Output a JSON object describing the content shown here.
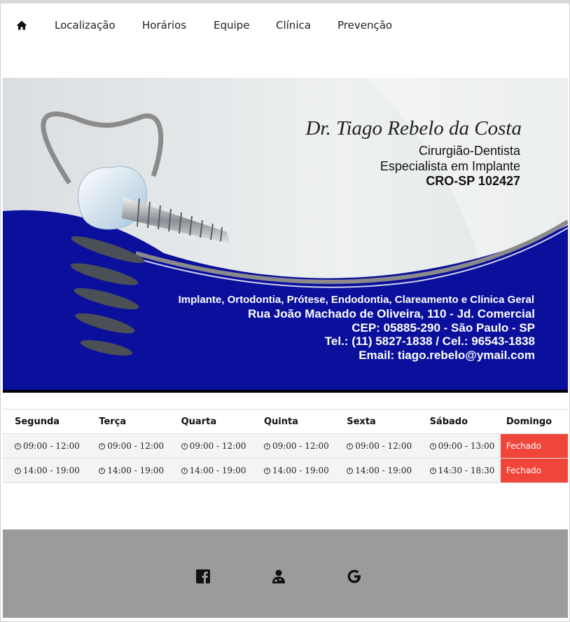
{
  "nav": {
    "home_icon": "home-icon",
    "items": [
      "Localização",
      "Horários",
      "Equipe",
      "Clínica",
      "Prevenção"
    ]
  },
  "banner": {
    "name": "Dr. Tiago Rebelo da Costa",
    "title1": "Cirurgião-Dentista",
    "title2": "Especialista em Implante",
    "cro": "CRO-SP 102427",
    "services": "Implante, Ortodontia, Prótese, Endodontia, Clareamento e Clínica Geral",
    "address": "Rua João Machado de Oliveira, 110 - Jd. Comercial",
    "cep": "CEP: 05885-290 - São Paulo - SP",
    "phone": "Tel.: (11) 5827-1838 / Cel.: 96543-1838",
    "email": "Email: tiago.rebelo@ymail.com",
    "colors": {
      "blue": "#0a0f9c",
      "grey": "#e4e7e8"
    }
  },
  "hours": {
    "days": [
      "Segunda",
      "Terça",
      "Quarta",
      "Quinta",
      "Sexta",
      "Sábado",
      "Domingo"
    ],
    "row1": [
      "09:00 - 12:00",
      "09:00 - 12:00",
      "09:00 - 12:00",
      "09:00 - 12:00",
      "09:00 - 12:00",
      "09:00 - 13:00",
      "Fechado"
    ],
    "row2": [
      "14:00 - 19:00",
      "14:00 - 19:00",
      "14:00 - 19:00",
      "14:00 - 19:00",
      "14:00 - 19:00",
      "14:30 - 18:30",
      "Fechado"
    ],
    "closed_color": "#f0453a"
  },
  "footer": {
    "icons": [
      "facebook-icon",
      "doctor-icon",
      "google-icon"
    ],
    "background": "#9b9b9b"
  }
}
